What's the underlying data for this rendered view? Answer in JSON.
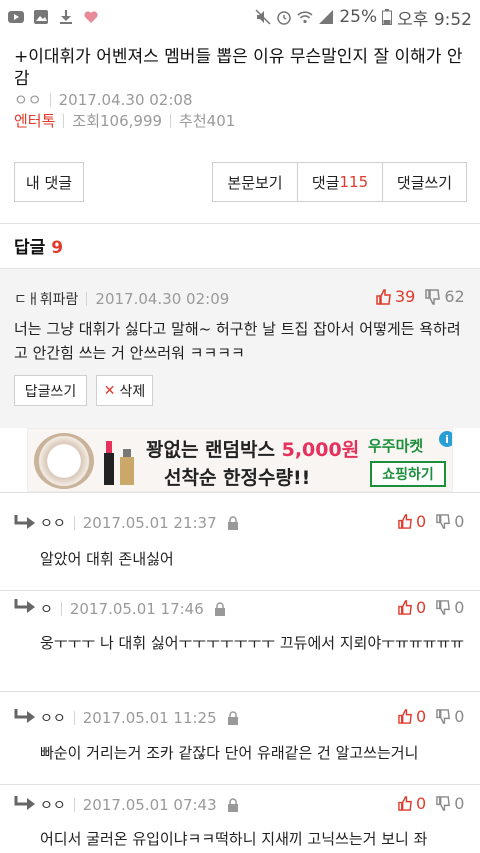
{
  "status_bar": {
    "battery": "25%",
    "time": "오후 9:52"
  },
  "article": {
    "title": "+이대휘가 어벤져스 멤버들 뽑은 이유 무슨말인지 잘 이해가 안감",
    "author": "ㅇㅇ",
    "date": "2017.04.30 02:08",
    "category": "엔터톡",
    "views": "조회106,999",
    "recommend": "추천401"
  },
  "buttons": {
    "my_comments": "내 댓글",
    "view_body": "본문보기",
    "comments_label": "댓글",
    "comments_count": "115",
    "write_comment": "댓글쓰기"
  },
  "replies": {
    "label": "답글",
    "count": "9"
  },
  "best_reply": {
    "author": "ㄷㅐ휘파람",
    "date": "2017.04.30 02:09",
    "up": "39",
    "down": "62",
    "text": "너는 그냥 대휘가 싫다고 말해~ 허구한 날 트집 잡아서 어떻게든 욕하려고 안간힘 쓰는 거 안쓰러워 ㅋㅋㅋㅋ",
    "reply_button": "답글쓰기",
    "delete_button": "삭제"
  },
  "ad": {
    "headline_a": "꽝없는 랜덤박스 ",
    "headline_price": "5,000원",
    "headline_b": "선착순 한정수량!!",
    "brand": "우주마켓",
    "cta": "쇼핑하기",
    "info_icon": "i",
    "close_icon": "✕"
  },
  "comments": [
    {
      "author": "ㅇㅇ",
      "date": "2017.05.01 21:37",
      "up": "0",
      "down": "0",
      "text": "알았어 대휘 존내싫어"
    },
    {
      "author": "ㅇ",
      "date": "2017.05.01 17:46",
      "up": "0",
      "down": "0",
      "text": "웅ㅜㅜㅜ 나 대휘 싫어ㅜㅜㅜㅜㅜㅜㅜ 끄듀에서 지뢰야ㅜㅠㅠㅠㅠㅠ"
    },
    {
      "author": "ㅇㅇ",
      "date": "2017.05.01 11:25",
      "up": "0",
      "down": "0",
      "text": "빠순이 거리는거 조카 같잖다 단어 유래같은 건 알고쓰는거니"
    },
    {
      "author": "ㅇㅇ",
      "date": "2017.05.01 07:43",
      "up": "0",
      "down": "0",
      "text": "어디서 굴러온 유입이냐ㅋㅋ떡하니 지새끼 고닉쓰는거 보니 좌"
    }
  ],
  "colors": {
    "accent_red": "#e03b2d",
    "ad_pink": "#e5315b",
    "ad_green": "#1b8f3a"
  }
}
